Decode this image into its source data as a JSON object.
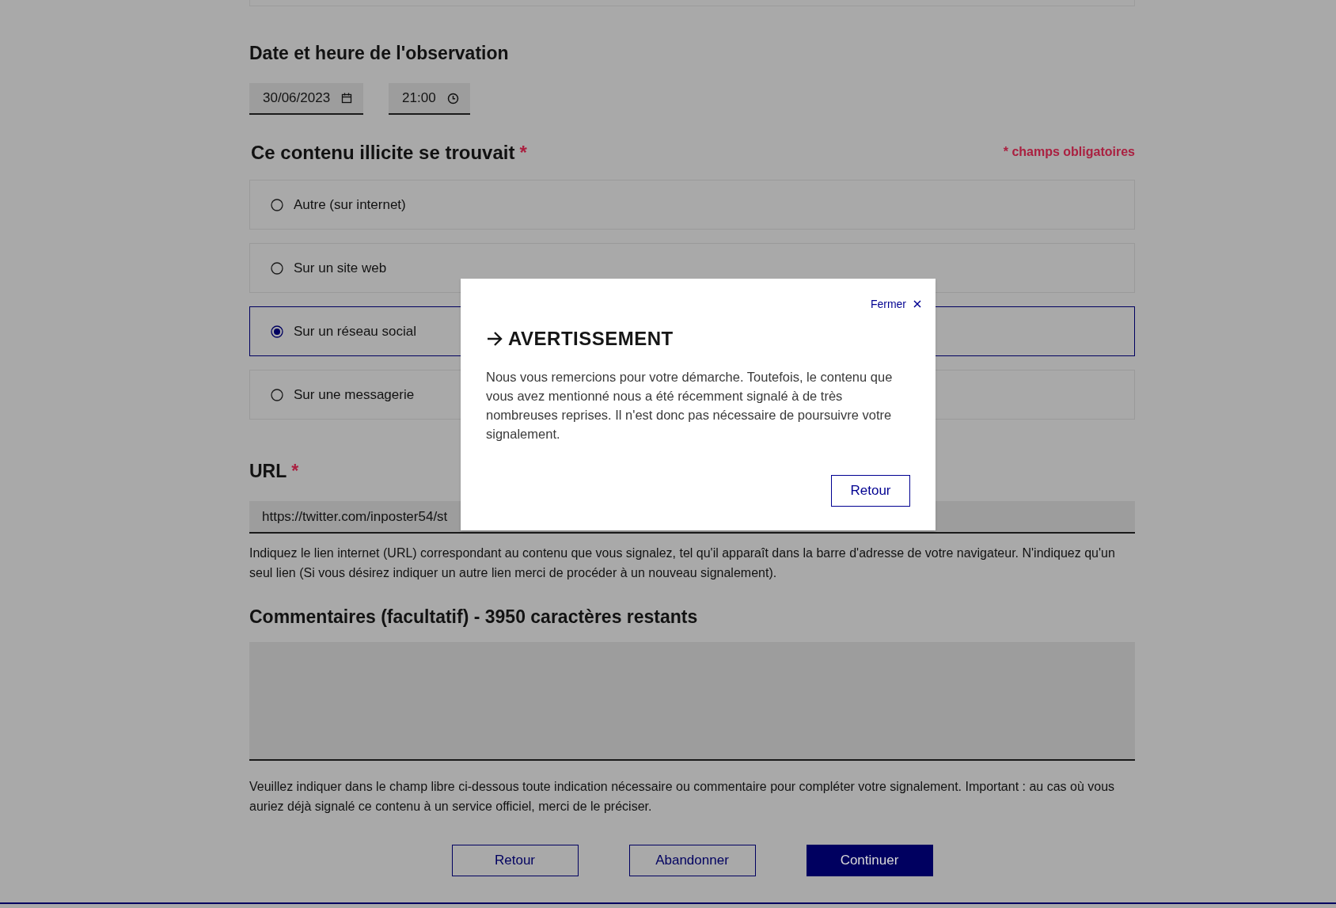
{
  "date_section": {
    "title": "Date et heure de l'observation",
    "date": "30/06/2023",
    "time": "21:00"
  },
  "location_section": {
    "title": "Ce contenu illicite se trouvait",
    "required_mark": "*",
    "legend": "* champs obligatoires",
    "options": [
      {
        "label": "Autre (sur internet)",
        "selected": false
      },
      {
        "label": "Sur un site web",
        "selected": false
      },
      {
        "label": "Sur un réseau social",
        "selected": true
      },
      {
        "label": "Sur une messagerie",
        "selected": false
      }
    ]
  },
  "url_section": {
    "title": "URL",
    "required_mark": "*",
    "value": "https://twitter.com/inposter54/st",
    "help": "Indiquez le lien internet (URL) correspondant au contenu que vous signalez, tel qu'il apparaît dans la barre d'adresse de votre navigateur. N'indiquez qu'un seul lien (Si vous désirez indiquer un autre lien merci de procéder à un nouveau signalement)."
  },
  "comment_section": {
    "title": "Commentaires (facultatif) - 3950 caractères restants",
    "help": "Veuillez indiquer dans le champ libre ci-dessous toute indication nécessaire ou commentaire pour compléter votre signalement. Important : au cas où vous auriez déjà signalé ce contenu à un service officiel, merci de le préciser."
  },
  "buttons": [
    {
      "label": "Retour",
      "kind": "secondary"
    },
    {
      "label": "Abandonner",
      "kind": "secondary"
    },
    {
      "label": "Continuer",
      "kind": "primary"
    }
  ],
  "modal": {
    "close_label": "Fermer",
    "title": "AVERTISSEMENT",
    "text": "Nous vous remercions pour votre démarche. Toutefois, le contenu que vous avez mentionné nous a été récemment signalé à de très nombreuses reprises. Il n'est donc pas nécessaire de poursuivre votre signalement.",
    "button": "Retour"
  }
}
